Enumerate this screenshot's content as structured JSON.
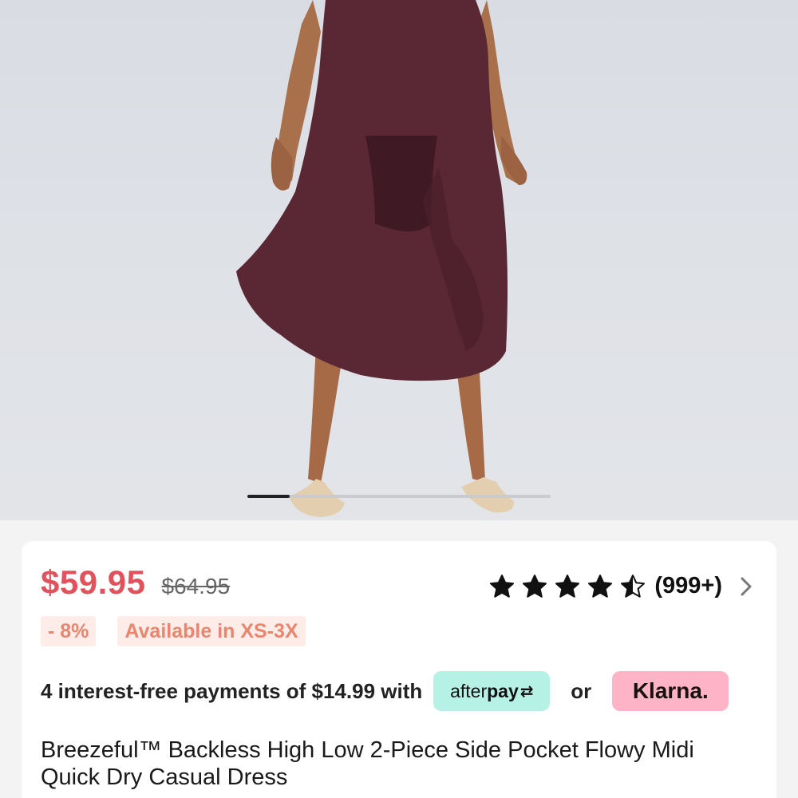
{
  "product": {
    "image": {
      "description_icon": "dress-photo",
      "carousel": {
        "current": 1,
        "progress": 0.14
      }
    },
    "price": {
      "current": "$59.95",
      "original": "$64.95"
    },
    "rating": {
      "stars": 4.5,
      "max": 5,
      "count": "(999+)"
    },
    "chips": {
      "discount": "- 8%",
      "sizes": "Available in XS-3X"
    },
    "payment": {
      "text": "4 interest-free payments of $14.99 with",
      "afterpay_label": "afterpay",
      "or": "or",
      "klarna_label": "Klarna."
    },
    "title": "Breezeful™ Backless High Low 2-Piece Side Pocket Flowy Midi Quick Dry Casual Dress"
  },
  "colors": {
    "price": "#e0535c",
    "chip_bg": "#fdece7",
    "chip_text": "#e8866f",
    "afterpay_bg": "#b6f1e5",
    "klarna_bg": "#ffb3c7",
    "dress": "#5a2734"
  }
}
